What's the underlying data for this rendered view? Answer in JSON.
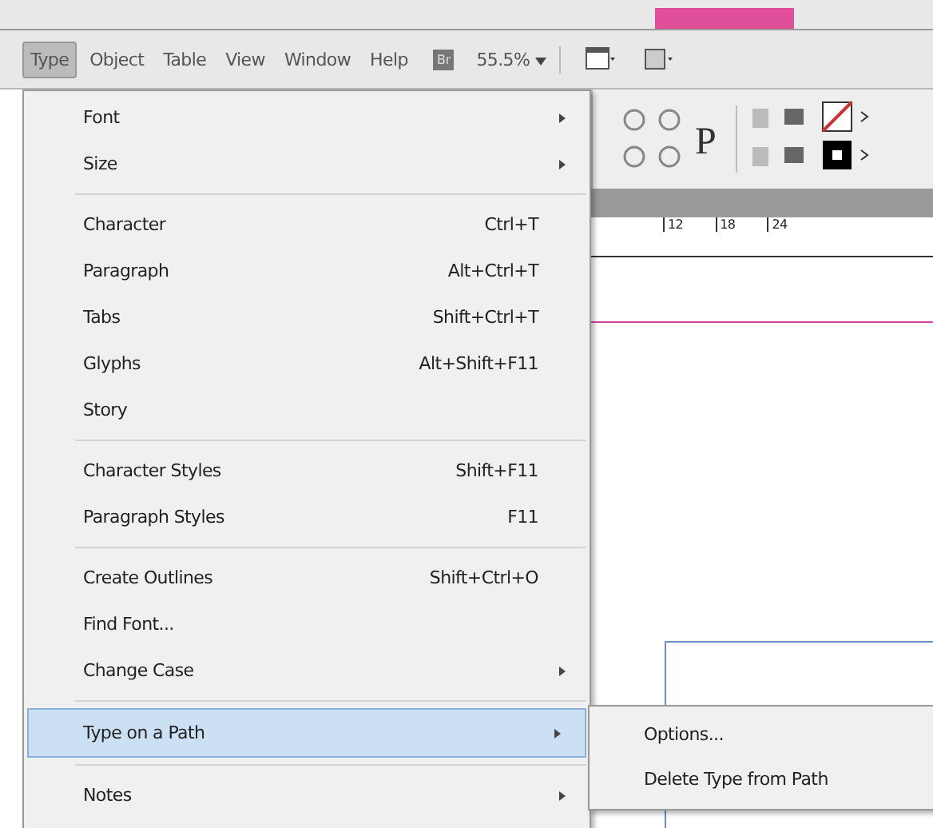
{
  "menu_bar": [
    {
      "label": "Type",
      "selected": true
    },
    {
      "label": "Object",
      "selected": false
    },
    {
      "label": "Table",
      "selected": false
    },
    {
      "label": "View",
      "selected": false
    },
    {
      "label": "Window",
      "selected": false
    },
    {
      "label": "Help",
      "selected": false
    }
  ],
  "bridge_button": "Br",
  "paragraph_glyph": "P",
  "zoom": "55.5%",
  "ruler": [
    "12",
    "18",
    "24"
  ],
  "menu": [
    [
      {
        "label": "Font",
        "submenu": true,
        "selected": false
      },
      {
        "label": "Size",
        "submenu": true,
        "selected": false
      }
    ],
    [
      {
        "label": "Character",
        "shortcut": "Ctrl+T",
        "submenu": false,
        "selected": false
      },
      {
        "label": "Paragraph",
        "shortcut": "Alt+Ctrl+T",
        "submenu": false,
        "selected": false
      },
      {
        "label": "Tabs",
        "shortcut": "Shift+Ctrl+T",
        "submenu": false,
        "selected": false
      },
      {
        "label": "Glyphs",
        "shortcut": "Alt+Shift+F11",
        "submenu": false,
        "selected": false
      },
      {
        "label": "Story",
        "submenu": false,
        "selected": false
      }
    ],
    [
      {
        "label": "Character Styles",
        "shortcut": "Shift+F11",
        "submenu": false,
        "selected": false
      },
      {
        "label": "Paragraph Styles",
        "shortcut": "F11",
        "submenu": false,
        "selected": false
      }
    ],
    [
      {
        "label": "Create Outlines",
        "shortcut": "Shift+Ctrl+O",
        "submenu": false,
        "selected": false
      },
      {
        "label": "Find Font...",
        "submenu": false,
        "selected": false
      },
      {
        "label": "Change Case",
        "submenu": true,
        "selected": false
      }
    ],
    [
      {
        "label": "Type on a Path",
        "submenu": true,
        "selected": true
      }
    ],
    [
      {
        "label": "Notes",
        "submenu": true,
        "selected": false
      }
    ]
  ],
  "submenu": [
    "Options...",
    "Delete Type from Path"
  ]
}
